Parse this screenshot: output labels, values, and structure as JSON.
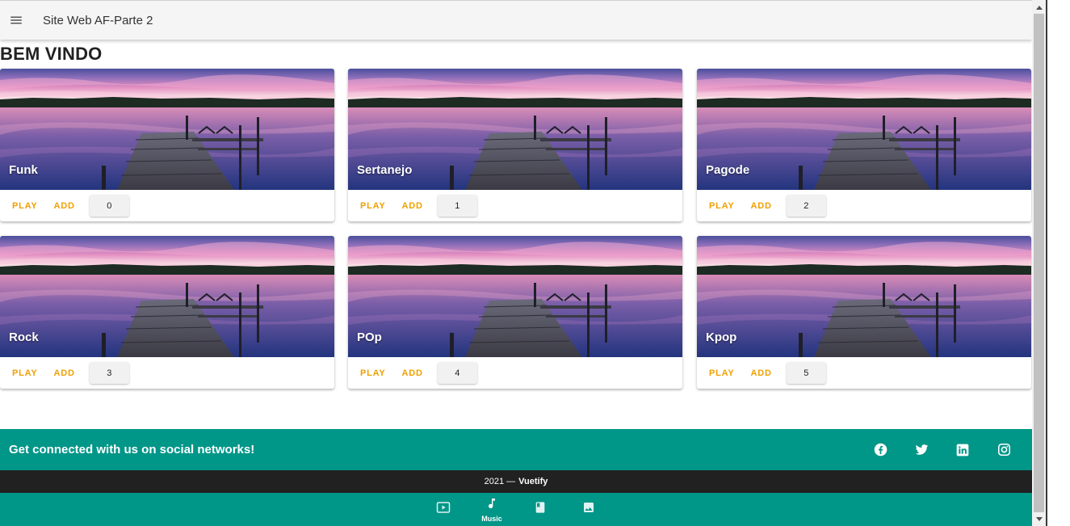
{
  "app": {
    "title": "Site Web AF-Parte 2",
    "menu_icon": "hamburger-menu-icon"
  },
  "page": {
    "heading": "BEM VINDO"
  },
  "cards": [
    {
      "title": "Funk",
      "play": "PLAY",
      "add": "ADD",
      "count": "0"
    },
    {
      "title": "Sertanejo",
      "play": "PLAY",
      "add": "ADD",
      "count": "1"
    },
    {
      "title": "Pagode",
      "play": "PLAY",
      "add": "ADD",
      "count": "2"
    },
    {
      "title": "Rock",
      "play": "PLAY",
      "add": "ADD",
      "count": "3"
    },
    {
      "title": "POp",
      "play": "PLAY",
      "add": "ADD",
      "count": "4"
    },
    {
      "title": "Kpop",
      "play": "PLAY",
      "add": "ADD",
      "count": "5"
    }
  ],
  "footer": {
    "social_text": "Get connected with us on social networks!",
    "social_icons": [
      "facebook-icon",
      "twitter-icon",
      "linkedin-icon",
      "instagram-icon"
    ],
    "year": "2021 —",
    "brand": "Vuetify"
  },
  "bottom_nav": {
    "items": [
      {
        "icon": "video-icon",
        "label": ""
      },
      {
        "icon": "music-note-icon",
        "label": "Music"
      },
      {
        "icon": "book-icon",
        "label": ""
      },
      {
        "icon": "image-icon",
        "label": ""
      }
    ]
  },
  "colors": {
    "accent": "#f0a000",
    "teal": "#009688",
    "dark": "#212121",
    "appbar": "#f5f5f5"
  }
}
